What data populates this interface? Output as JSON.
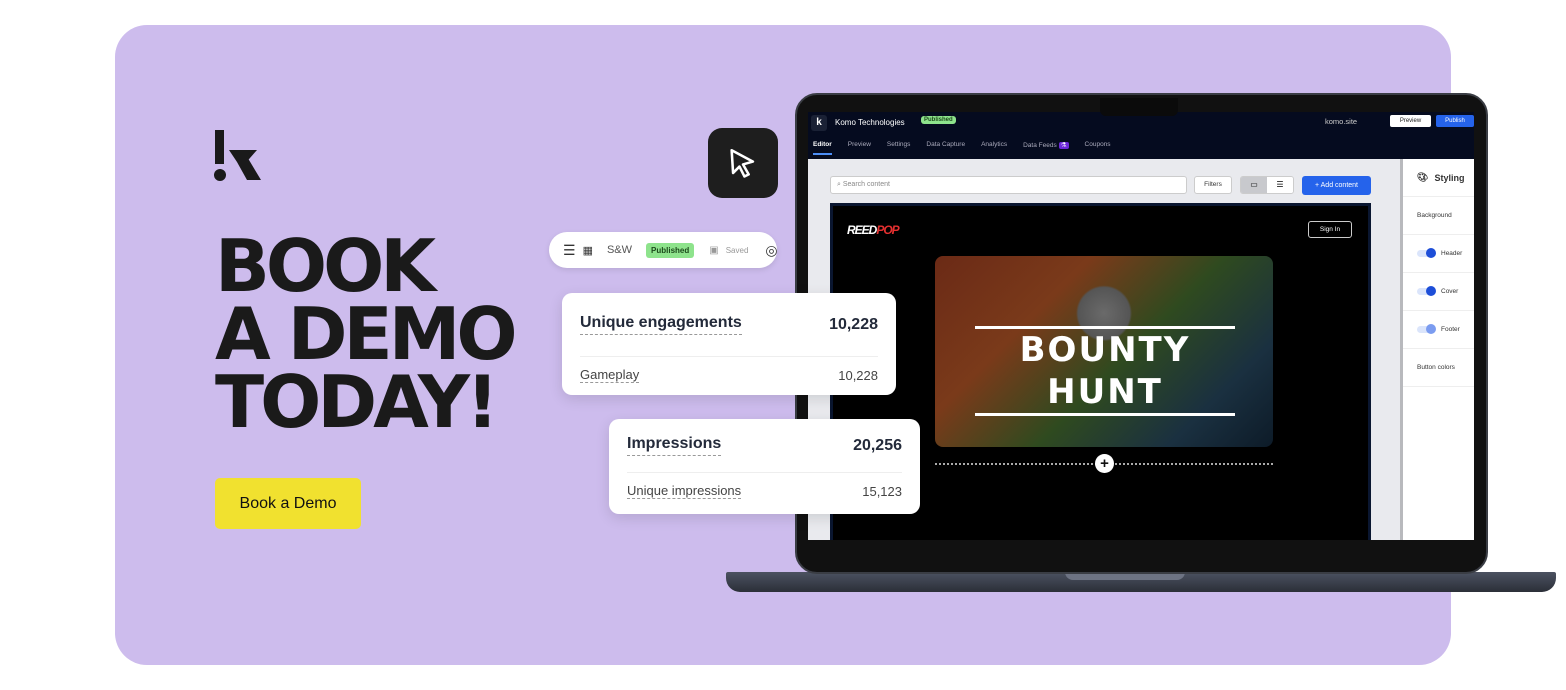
{
  "brand": {
    "logo_text": "k",
    "accent": "#cdbced",
    "cta_color": "#f1e12f"
  },
  "headline": [
    "BOOK",
    "A DEMO",
    "TODAY!"
  ],
  "cta_label": "Book a Demo",
  "pill": {
    "project": "S&W",
    "status": "Published",
    "saved": "Saved",
    "icons": [
      "menu-icon",
      "calendar-icon",
      "save-icon",
      "help-icon"
    ]
  },
  "stats": [
    {
      "title": "Unique engagements",
      "value": "10,228",
      "sub_label": "Gameplay",
      "sub_value": "10,228"
    },
    {
      "title": "Impressions",
      "value": "20,256",
      "sub_label": "Unique impressions",
      "sub_value": "15,123"
    }
  ],
  "app": {
    "logo": "k",
    "title": "Komo Technologies",
    "status": "Published",
    "site": "komo.site",
    "preview": "Preview",
    "publish": "Publish",
    "tabs": [
      "Editor",
      "Preview",
      "Settings",
      "Data Capture",
      "Analytics",
      "Data Feeds",
      "Coupons"
    ],
    "search_placeholder": "Search content",
    "filters": "Filters",
    "add_content": "+ Add content",
    "game": {
      "brand": "REEDPOP",
      "sign_in": "Sign In",
      "title": "BOUNTY HUNT"
    },
    "panel": {
      "title": "Styling",
      "background": "Background",
      "header": "Header",
      "cover": "Cover",
      "footer": "Footer",
      "button_colors": "Button colors"
    }
  }
}
